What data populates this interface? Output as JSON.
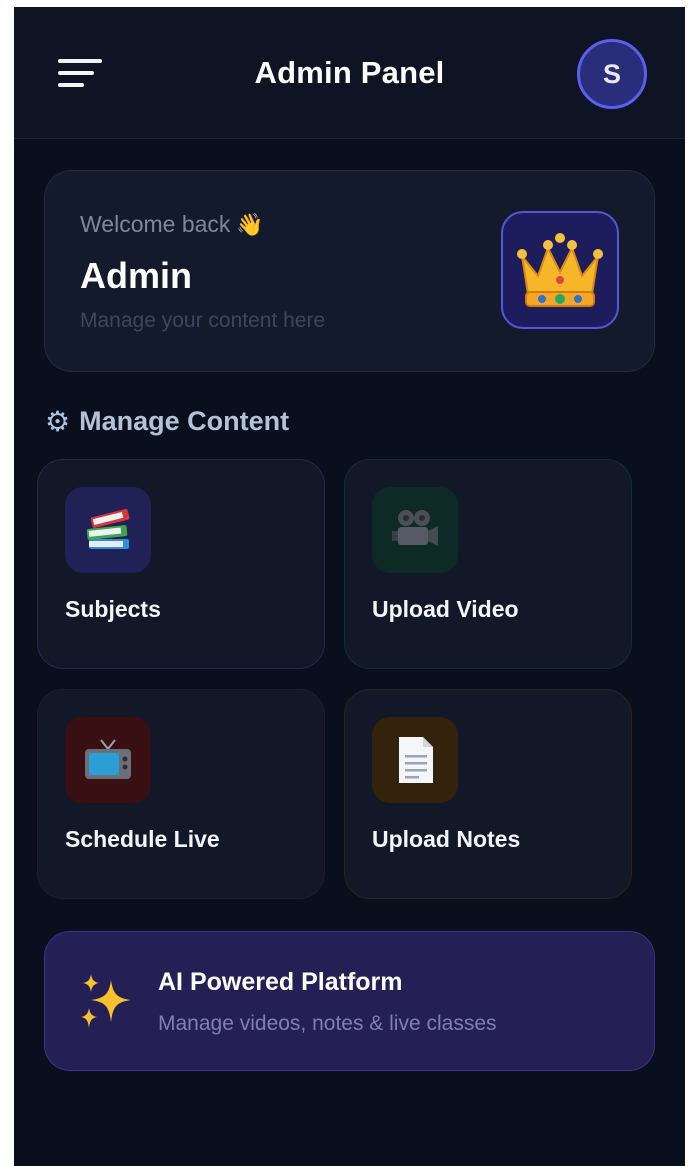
{
  "header": {
    "title": "Admin Panel",
    "avatar_initial": "S"
  },
  "welcome": {
    "greeting": "Welcome back",
    "greeting_emoji": "👋",
    "name": "Admin",
    "subtitle": "Manage your content here",
    "icon": "crown-icon"
  },
  "section": {
    "icon": "gear-icon",
    "title": "Manage Content"
  },
  "tiles": [
    {
      "label": "Subjects",
      "icon": "books-icon",
      "accent": "#1f2157"
    },
    {
      "label": "Upload Video",
      "icon": "movie-camera-icon",
      "accent": "#0d2b24"
    },
    {
      "label": "Schedule Live",
      "icon": "television-icon",
      "accent": "#3a0f14"
    },
    {
      "label": "Upload Notes",
      "icon": "document-icon",
      "accent": "#33220c"
    }
  ],
  "banner": {
    "icon": "sparkles-icon",
    "title": "AI Powered Platform",
    "subtitle": "Manage videos, notes & live classes"
  },
  "colors": {
    "background": "#0a0f1e",
    "card": "#131a2c",
    "brand": "#5b5ff0",
    "banner": "#241f55"
  }
}
